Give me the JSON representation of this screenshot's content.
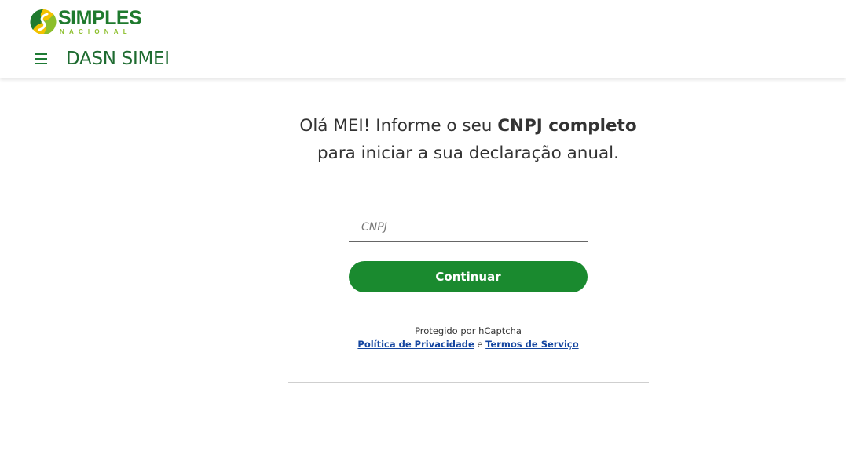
{
  "brand": {
    "name": "SIMPLES",
    "subtitle": "NACIONAL",
    "colors": {
      "dark_green": "#1f7a2e",
      "light_green": "#8cbf2b",
      "yellow": "#f2c200"
    }
  },
  "header": {
    "menu_icon": "hamburger-menu-icon",
    "title": "DASN SIMEI"
  },
  "main": {
    "headline_part1": "Olá MEI! Informe o seu ",
    "headline_bold": "CNPJ completo",
    "headline_part2": "para iniciar a sua declaração anual.",
    "cnpj_field": {
      "placeholder": "CNPJ",
      "value": ""
    },
    "continue_label": "Continuar",
    "button_color": "#1a8a2f"
  },
  "captcha": {
    "protected_text": "Protegido por hCaptcha",
    "privacy_link": "Política de Privacidade",
    "conjunction": " e ",
    "terms_link": "Termos de Serviço",
    "link_color": "#1546a0"
  }
}
